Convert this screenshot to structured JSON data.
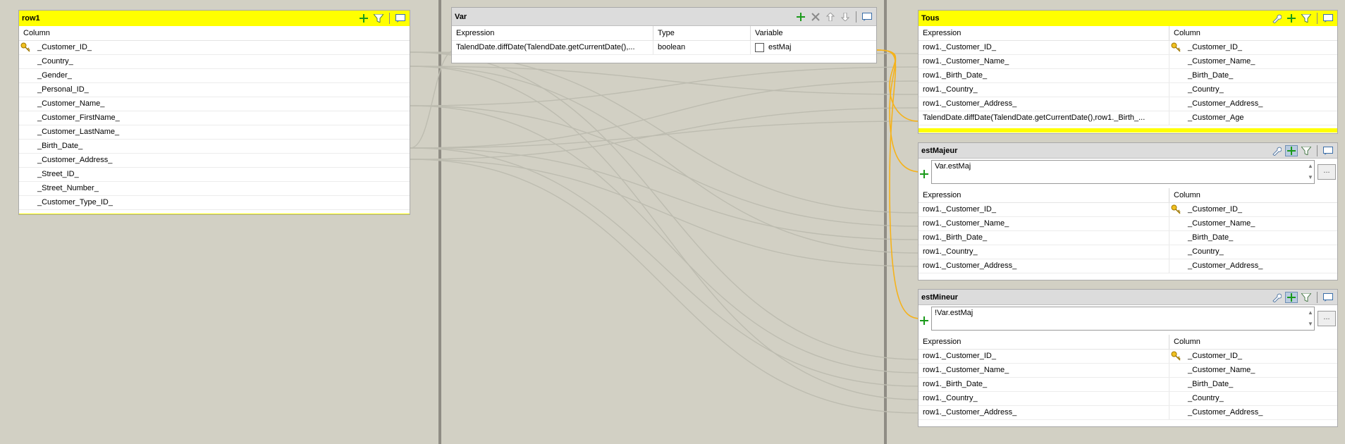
{
  "colors": {
    "panel_header_yellow": "#ffff00",
    "connector_orange": "#f5b21b",
    "link_grey": "#bdbcb0"
  },
  "input": {
    "title": "row1",
    "column_header": "Column",
    "columns": [
      "_Customer_ID_",
      "_Country_",
      "_Gender_",
      "_Personal_ID_",
      "_Customer_Name_",
      "_Customer_FirstName_",
      "_Customer_LastName_",
      "_Birth_Date_",
      "_Customer_Address_",
      "_Street_ID_",
      "_Street_Number_",
      "_Customer_Type_ID_"
    ],
    "key_columns": [
      0
    ],
    "icons": [
      "add-plus-icon",
      "filter-icon",
      "expression-editor-icon"
    ]
  },
  "var": {
    "title": "Var",
    "headers": {
      "expression": "Expression",
      "type": "Type",
      "variable": "Variable"
    },
    "rows": [
      {
        "expression": "TalendDate.diffDate(TalendDate.getCurrentDate(),...",
        "type": "boolean",
        "variable": "estMaj"
      }
    ],
    "icons": [
      "add-plus-icon",
      "delete-x-icon",
      "move-up-icon",
      "move-down-icon",
      "expression-editor-icon"
    ]
  },
  "outputs": [
    {
      "title": "Tous",
      "yellow": true,
      "filter": null,
      "headers": {
        "expression": "Expression",
        "column": "Column"
      },
      "rows": [
        {
          "expression": "row1._Customer_ID_",
          "column": "_Customer_ID_",
          "key": true
        },
        {
          "expression": "row1._Customer_Name_",
          "column": "_Customer_Name_"
        },
        {
          "expression": "row1._Birth_Date_",
          "column": "_Birth_Date_"
        },
        {
          "expression": "row1._Country_",
          "column": "_Country_"
        },
        {
          "expression": "row1._Customer_Address_",
          "column": "_Customer_Address_"
        },
        {
          "expression": "TalendDate.diffDate(TalendDate.getCurrentDate(),row1._Birth_...",
          "column": "_Customer_Age"
        }
      ]
    },
    {
      "title": "estMajeur",
      "yellow": false,
      "filter": "Var.estMaj",
      "headers": {
        "expression": "Expression",
        "column": "Column"
      },
      "rows": [
        {
          "expression": "row1._Customer_ID_",
          "column": "_Customer_ID_",
          "key": true
        },
        {
          "expression": "row1._Customer_Name_",
          "column": "_Customer_Name_"
        },
        {
          "expression": "row1._Birth_Date_",
          "column": "_Birth_Date_"
        },
        {
          "expression": "row1._Country_",
          "column": "_Country_"
        },
        {
          "expression": "row1._Customer_Address_",
          "column": "_Customer_Address_"
        }
      ]
    },
    {
      "title": "estMineur",
      "yellow": false,
      "filter": "!Var.estMaj",
      "headers": {
        "expression": "Expression",
        "column": "Column"
      },
      "rows": [
        {
          "expression": "row1._Customer_ID_",
          "column": "_Customer_ID_",
          "key": true
        },
        {
          "expression": "row1._Customer_Name_",
          "column": "_Customer_Name_"
        },
        {
          "expression": "row1._Birth_Date_",
          "column": "_Birth_Date_"
        },
        {
          "expression": "row1._Country_",
          "column": "_Country_"
        },
        {
          "expression": "row1._Customer_Address_",
          "column": "_Customer_Address_"
        }
      ]
    }
  ],
  "filter_more_button": "..."
}
